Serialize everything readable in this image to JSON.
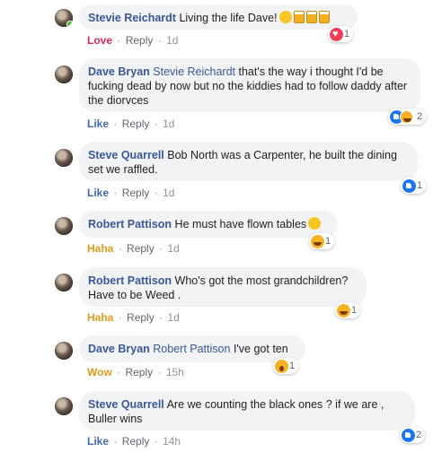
{
  "comments": [
    {
      "author": "Stevie Reichardt",
      "mention": "",
      "text": "Living the life Dave!",
      "emojis": [
        "rofl-emoji",
        "beer-emoji",
        "beer-emoji",
        "beer-emoji"
      ],
      "reaction_label": "Love",
      "reply": "Reply",
      "time": "1d",
      "reaction_count": "1"
    },
    {
      "author": "Dave Bryan",
      "mention": "Stevie Reichardt",
      "text": "that's the way i thought I'd be fucking dead by now but no the kiddies had to follow daddy after the diorvces",
      "reaction_label": "Like",
      "reply": "Reply",
      "time": "1d",
      "reaction_count": "2"
    },
    {
      "author": "Steve Quarrell",
      "mention": "",
      "text": "Bob North was a Carpenter, he built the dining set we raffled.",
      "reaction_label": "Like",
      "reply": "Reply",
      "time": "1d",
      "reaction_count": "1"
    },
    {
      "author": "Robert Pattison",
      "mention": "",
      "text": "He must have flown tables",
      "reaction_label": "Haha",
      "reply": "Reply",
      "time": "1d",
      "reaction_count": "1"
    },
    {
      "author": "Robert Pattison",
      "mention": "",
      "text": "Who's got the most grandchildren? Have to be Weed .",
      "reaction_label": "Haha",
      "reply": "Reply",
      "time": "1d",
      "reaction_count": "1"
    },
    {
      "author": "Dave Bryan",
      "mention": "Robert Pattison",
      "text": "I've got ten",
      "reaction_label": "Wow",
      "reply": "Reply",
      "time": "15h",
      "reaction_count": "1"
    },
    {
      "author": "Steve Quarrell",
      "mention": "",
      "text": "Are we counting the black ones ? if we are , Buller wins",
      "reaction_label": "Like",
      "reply": "Reply",
      "time": "14h",
      "reaction_count": "2"
    }
  ],
  "separator": "·",
  "colors": {
    "link": "#385898",
    "like": "#4267b2",
    "love": "#e0245e",
    "haha": "#e09b1d",
    "bubble": "#f2f3f5"
  }
}
